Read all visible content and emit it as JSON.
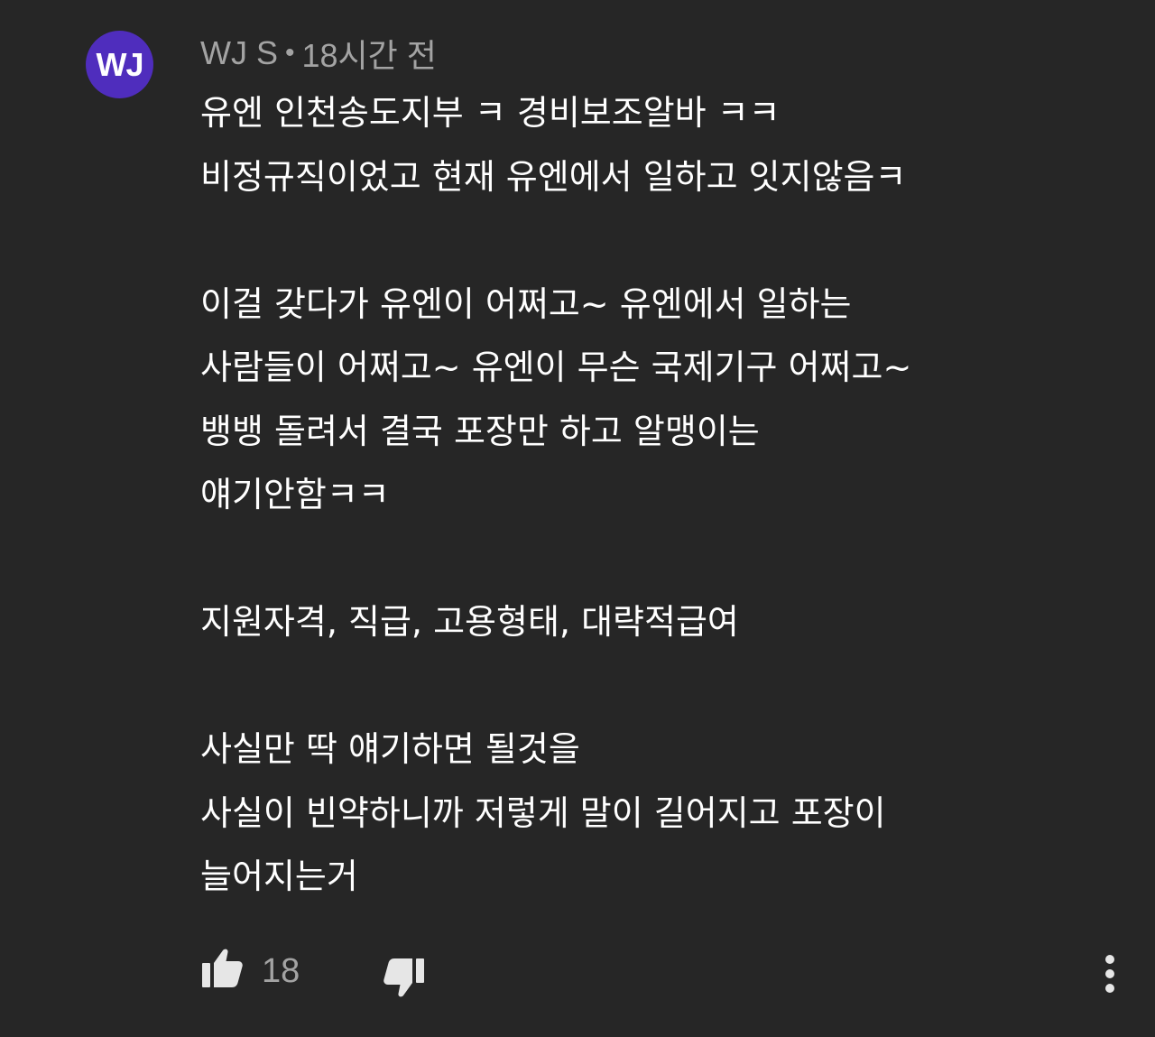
{
  "comment": {
    "avatar_initials": "WJ",
    "avatar_color": "#4f2dbd",
    "author": "WJ S",
    "separator": "•",
    "time": "18시간 전",
    "lines": [
      "유엔 인천송도지부 ㅋ 경비보조알바 ㅋㅋ",
      "비정규직이었고 현재 유엔에서 일하고 잇지않음ㅋ",
      "",
      "이걸 갖다가 유엔이 어쩌고~ 유엔에서 일하는",
      "사람들이 어쩌고~ 유엔이 무슨 국제기구 어쩌고~",
      "뱅뱅 돌려서 결국 포장만 하고 알맹이는",
      "얘기안함ㅋㅋ",
      "",
      "지원자격, 직급, 고용형태, 대략적급여",
      "",
      "사실만 딱 얘기하면 될것을",
      "사실이 빈약하니까 저렇게 말이 길어지고 포장이",
      "늘어지는거"
    ],
    "like_count": "18",
    "icons": {
      "like": "thumbs-up-icon",
      "dislike": "thumbs-down-icon",
      "more": "more-vert-icon"
    },
    "colors": {
      "background": "#262626",
      "text": "#ffffff",
      "meta": "#a3a3a3",
      "icon": "#e6e6e6"
    }
  }
}
